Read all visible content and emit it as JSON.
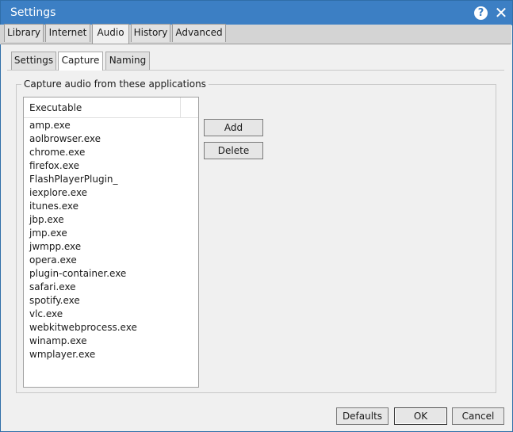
{
  "window": {
    "title": "Settings",
    "help_icon": "question-mark-icon",
    "close_icon": "close-icon"
  },
  "tabs": [
    {
      "label": "Library"
    },
    {
      "label": "Internet"
    },
    {
      "label": "Audio",
      "active": true
    },
    {
      "label": "History"
    },
    {
      "label": "Advanced"
    }
  ],
  "subtabs": [
    {
      "label": "Settings"
    },
    {
      "label": "Capture",
      "active": true
    },
    {
      "label": "Naming"
    }
  ],
  "capture": {
    "group_label": "Capture audio from these applications",
    "column_header": "Executable",
    "executables": [
      "amp.exe",
      "aolbrowser.exe",
      "chrome.exe",
      "firefox.exe",
      "FlashPlayerPlugin_",
      "iexplore.exe",
      "itunes.exe",
      "jbp.exe",
      "jmp.exe",
      "jwmpp.exe",
      "opera.exe",
      "plugin-container.exe",
      "safari.exe",
      "spotify.exe",
      "vlc.exe",
      "webkitwebprocess.exe",
      "winamp.exe",
      "wmplayer.exe"
    ],
    "add_label": "Add",
    "delete_label": "Delete"
  },
  "footer": {
    "defaults_label": "Defaults",
    "ok_label": "OK",
    "cancel_label": "Cancel"
  },
  "colors": {
    "titlebar": "#3c7fc4",
    "panel": "#f0f0f0"
  }
}
